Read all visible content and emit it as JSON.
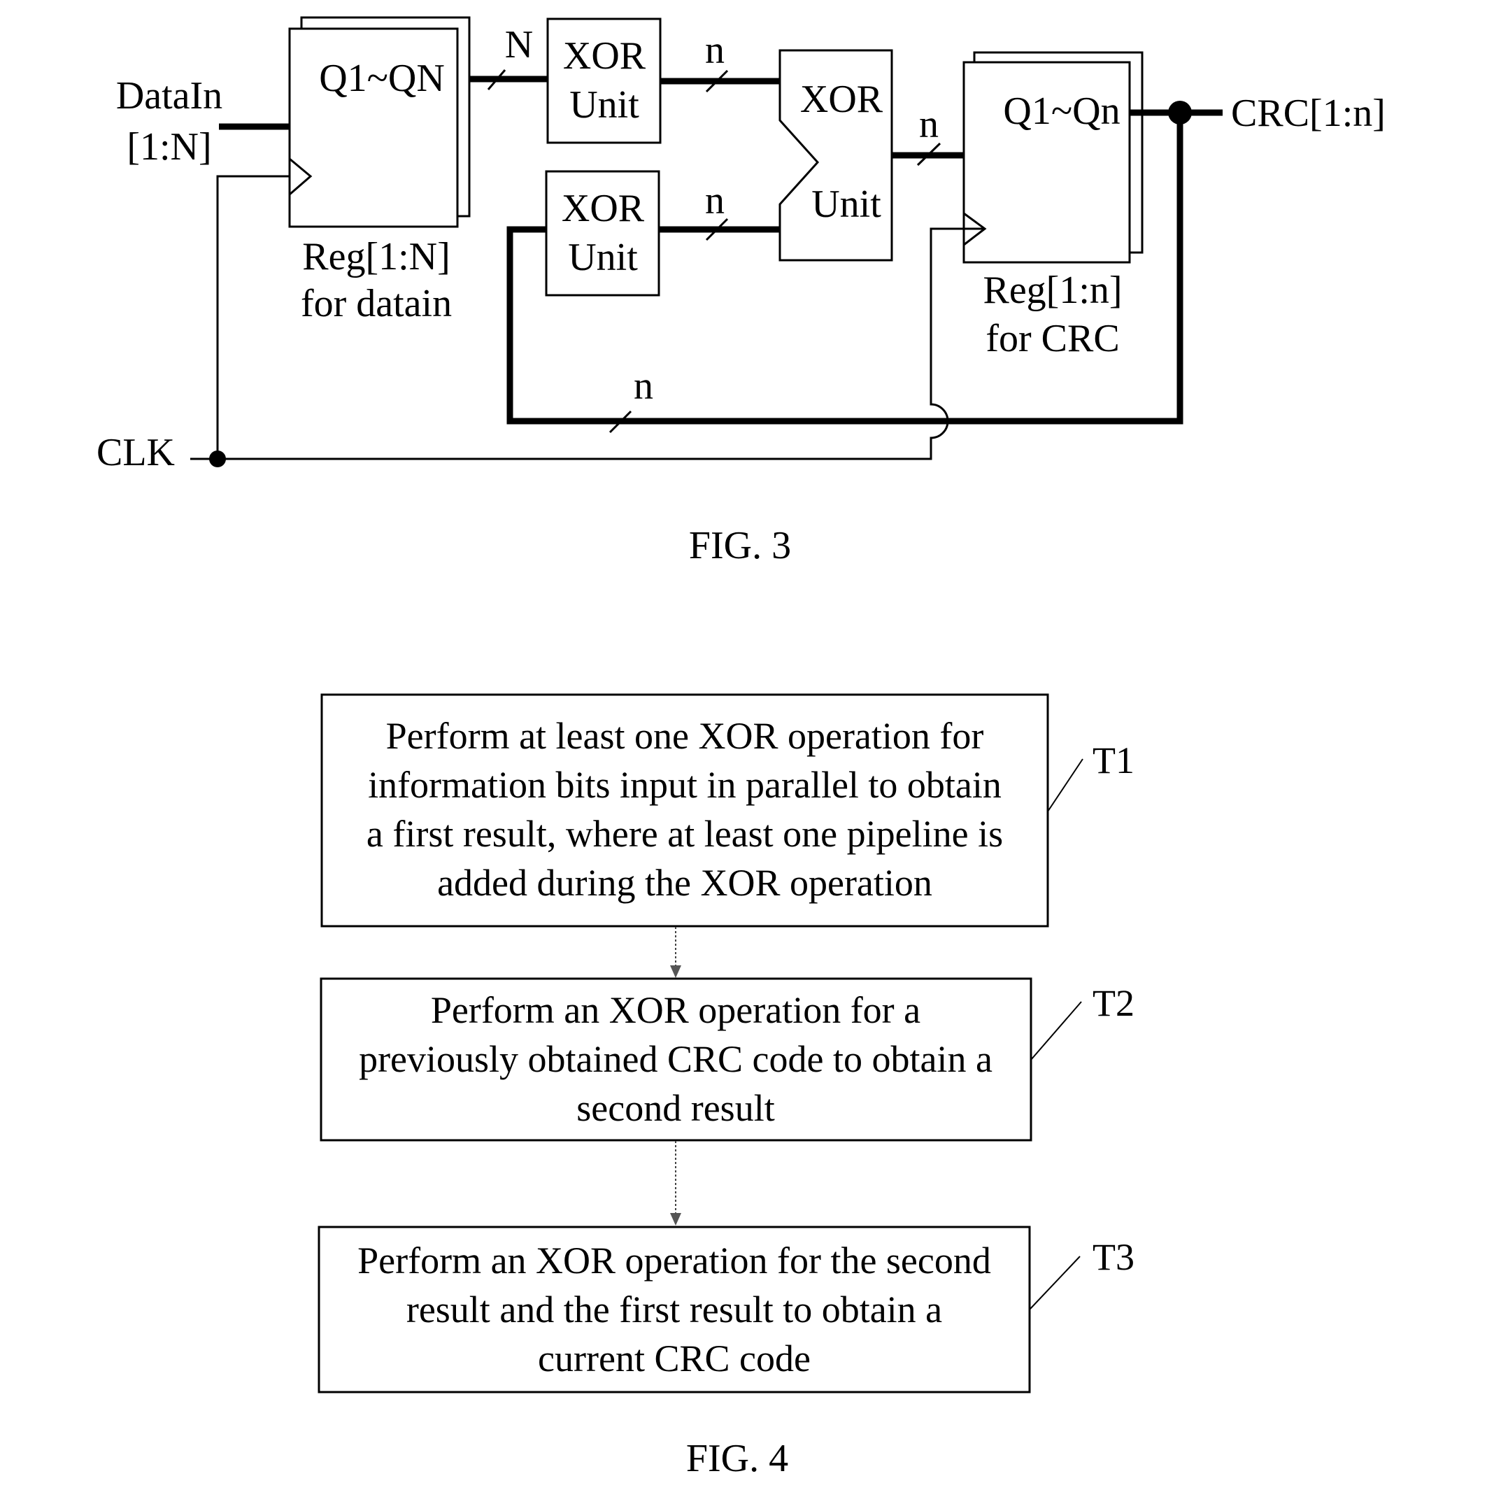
{
  "fig3": {
    "caption": "FIG. 3",
    "input_label_line1": "DataIn",
    "input_label_line2": "[1:N]",
    "clock_label": "CLK",
    "data_register": {
      "outputs": "Q1~QN",
      "label_line1": "Reg[1:N]",
      "label_line2": "for datain"
    },
    "xor_unit_top": {
      "line1": "XOR",
      "line2": "Unit"
    },
    "xor_unit_bottom": {
      "line1": "XOR",
      "line2": "Unit"
    },
    "xor_unit_combine": {
      "line1": "XOR",
      "line2": "Unit"
    },
    "crc_register": {
      "outputs": "Q1~Qn",
      "label_line1": "Reg[1:n]",
      "label_line2": "for CRC"
    },
    "output_label": "CRC[1:n]",
    "bus_widths": {
      "data_reg_to_xor": "N",
      "xor_top_to_combine": "n",
      "xor_bottom_to_combine": "n",
      "combine_to_crc_reg": "n",
      "feedback": "n"
    }
  },
  "fig4": {
    "caption": "FIG. 4",
    "steps": [
      {
        "id": "T1",
        "lines": [
          "Perform at least one XOR operation for",
          "information bits input in parallel to obtain",
          "a first result, where at least one pipeline is",
          "added during the XOR operation"
        ]
      },
      {
        "id": "T2",
        "lines": [
          "Perform an XOR operation for a",
          "previously obtained CRC code to obtain a",
          "second result"
        ]
      },
      {
        "id": "T3",
        "lines": [
          "Perform an XOR operation for the second",
          "result and the first result to obtain a",
          "current CRC code"
        ]
      }
    ]
  }
}
